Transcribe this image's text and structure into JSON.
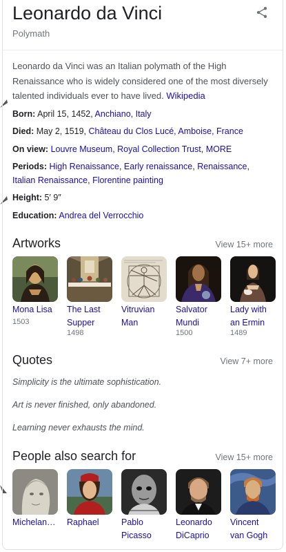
{
  "header": {
    "title": "Leonardo da Vinci",
    "subtitle": "Polymath"
  },
  "description": {
    "text": "Leonardo da Vinci was an Italian polymath of the High Renaissance who is widely considered one of the most diversely talented individuals ever to have lived.",
    "source": "Wikipedia"
  },
  "facts": {
    "born": {
      "label": "Born:",
      "date": "April 15, 1452,",
      "place": "Anchiano, Italy"
    },
    "died": {
      "label": "Died:",
      "date": "May 2, 1519,",
      "place": "Château du Clos Lucé, Amboise, France"
    },
    "on_view": {
      "label": "On view:",
      "v1": "Louvre Museum",
      "v2": "Royal Collection Trust",
      "v3": "MORE"
    },
    "periods": {
      "label": "Periods:",
      "v1": "High Renaissance",
      "v2": "Early renaissance",
      "v3": "Renaissance",
      "v4": "Italian Renaissance",
      "v5": "Florentine painting"
    },
    "height": {
      "label": "Height:",
      "value": "5′ 9″"
    },
    "education": {
      "label": "Education:",
      "value": "Andrea del Verrocchio"
    }
  },
  "artworks": {
    "title": "Artworks",
    "view_more": "View 15+ more",
    "items": [
      {
        "name_1": "Mona Lisa",
        "name_2": "",
        "year": "1503"
      },
      {
        "name_1": "The Last",
        "name_2": "Supper",
        "year": "1498"
      },
      {
        "name_1": "Vitruvian",
        "name_2": "Man",
        "year": ""
      },
      {
        "name_1": "Salvator",
        "name_2": "Mundi",
        "year": "1500"
      },
      {
        "name_1": "Lady with",
        "name_2": "an Ermin",
        "year": "1489"
      }
    ]
  },
  "quotes": {
    "title": "Quotes",
    "view_more": "View 7+ more",
    "items": [
      "Simplicity is the ultimate sophistication.",
      "Art is never finished, only abandoned.",
      "Learning never exhausts the mind."
    ]
  },
  "people": {
    "title": "People also search for",
    "view_more": "View 15+ more",
    "items": [
      {
        "name_1": "Michelan…",
        "name_2": ""
      },
      {
        "name_1": "Raphael",
        "name_2": ""
      },
      {
        "name_1": "Pablo",
        "name_2": "Picasso"
      },
      {
        "name_1": "Leonardo",
        "name_2": "DiCaprio"
      },
      {
        "name_1": "Vincent",
        "name_2": "van Gogh"
      }
    ]
  },
  "colors": {
    "link": "#1a0dab",
    "text": "#202124",
    "secondary": "#70757a",
    "border": "#dfe1e5"
  }
}
